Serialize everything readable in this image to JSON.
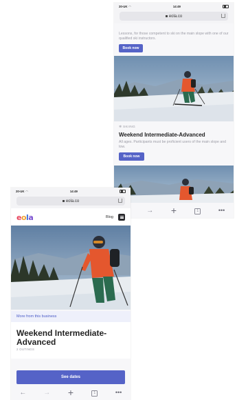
{
  "right_phone": {
    "status": {
      "carrier": "20-UK",
      "time": "14:49"
    },
    "url": "eola.co",
    "description_top": "Lessons, for those competent to ski on the main slope with one of our qualified ski instructors.",
    "book_label": "Book now",
    "category": "SKIING",
    "listing_title": "Weekend Intermediate-Advanced",
    "listing_subtitle": "All ages. Participants must be proficient users of the main slope and tow.",
    "book_label_2": "Book now"
  },
  "left_phone": {
    "status": {
      "carrier": "20-UK",
      "time": "14:49"
    },
    "url": "eola.co",
    "logo": {
      "letters": [
        "e",
        "o",
        "l",
        "a"
      ]
    },
    "blog_label": "Blog",
    "more_from_business": "More from this business",
    "title": "Weekend Intermediate-Advanced",
    "subtitle": "2 OUTINGS",
    "cta_label": "See dates"
  },
  "colors": {
    "accent": "#5563c7",
    "link": "#4b5bc7",
    "logo": [
      "#e8455e",
      "#f0a030",
      "#3f6fd8",
      "#7a4fd0"
    ]
  },
  "icons": [
    "wifi-icon",
    "battery-icon",
    "lock-icon",
    "share-icon",
    "back-arrow-icon",
    "forward-arrow-icon",
    "new-tab-icon",
    "tabs-icon",
    "more-icon",
    "menu-icon"
  ]
}
